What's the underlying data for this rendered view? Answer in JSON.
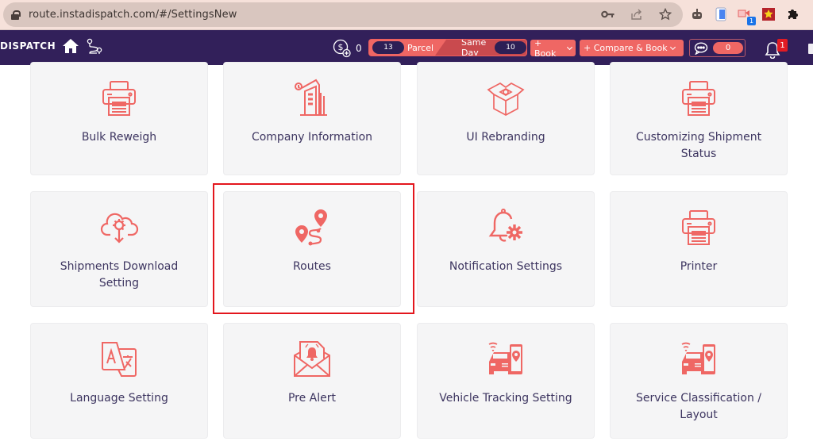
{
  "browser": {
    "url": "route.instadispatch.com/#/SettingsNew",
    "omnibox_icons": [
      "key-icon",
      "share-icon",
      "star-icon"
    ],
    "extension_icons": [
      "robot-extension-icon",
      "phone-extension-icon",
      "video-extension-icon",
      "star-extension-icon",
      "puzzle-extension-icon"
    ],
    "extension_badge": "1"
  },
  "navbar": {
    "brand": "DISPATCH",
    "wallet_balance": "0",
    "parcel": {
      "count": "13",
      "label": "Parcel"
    },
    "same_day": {
      "label": "Same Day",
      "count": "10"
    },
    "book_label": "+ Book",
    "compare_book_label": "+ Compare & Book",
    "chat_count": "0",
    "notification_count": "1"
  },
  "colors": {
    "nav_bg": "#32205a",
    "accent": "#ef6764",
    "card_bg": "#f5f5f6",
    "label_text": "#3d3560",
    "highlight": "#e3161d"
  },
  "settings": [
    {
      "label": "Bulk Reweigh",
      "icon": "printer-icon"
    },
    {
      "label": "Company Information",
      "icon": "building-icon"
    },
    {
      "label": "UI Rebranding",
      "icon": "box-gear-icon"
    },
    {
      "label": "Customizing Shipment Status",
      "icon": "printer-icon"
    },
    {
      "label": "Shipments Download Setting",
      "icon": "cloud-download-gear-icon"
    },
    {
      "label": "Routes",
      "icon": "route-pins-icon",
      "highlighted": true
    },
    {
      "label": "Notification Settings",
      "icon": "bell-gear-icon"
    },
    {
      "label": "Printer",
      "icon": "printer-icon"
    },
    {
      "label": "Language Setting",
      "icon": "translate-icon"
    },
    {
      "label": "Pre Alert",
      "icon": "envelope-bell-icon"
    },
    {
      "label": "Vehicle Tracking Setting",
      "icon": "car-tracking-icon"
    },
    {
      "label": "Service Classification / Layout",
      "icon": "car-tracking-icon"
    }
  ]
}
